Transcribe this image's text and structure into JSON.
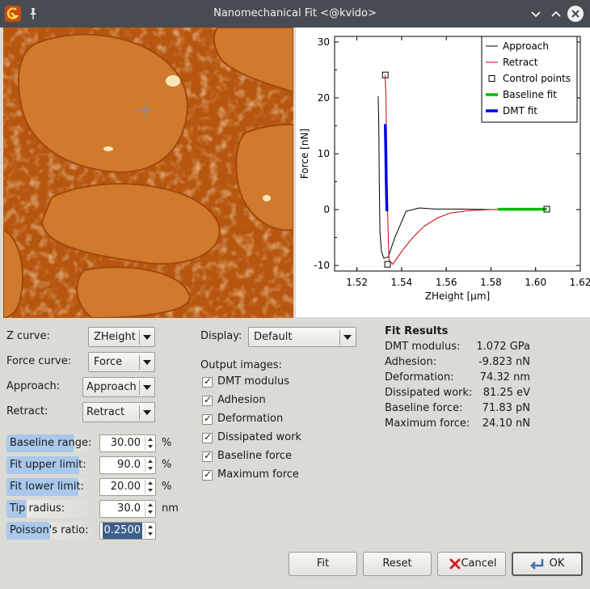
{
  "window": {
    "title": "Nanomechanical Fit <@kvido>",
    "minimize_icon": "chevron-down",
    "maximize_icon": "chevron-up",
    "close_icon": "close"
  },
  "chart_data": {
    "type": "line",
    "xlabel": "ZHeight [µm]",
    "ylabel": "Force [nN]",
    "xlim": [
      1.51,
      1.62
    ],
    "ylim": [
      -11,
      31
    ],
    "xticks": [
      "1.52",
      "1.54",
      "1.56",
      "1.58",
      "1.60",
      "1.62"
    ],
    "yticks": [
      "-10",
      "0",
      "10",
      "20",
      "30"
    ],
    "legend_position": "top-right",
    "legend": [
      "Approach",
      "Retract",
      "Control points",
      "Baseline fit",
      "DMT fit"
    ],
    "series": [
      {
        "name": "Approach",
        "color": "#000000",
        "x": [
          1.5295,
          1.5298,
          1.53,
          1.5303,
          1.531,
          1.532,
          1.534,
          1.537,
          1.542,
          1.548,
          1.555,
          1.565,
          1.58,
          1.595,
          1.605
        ],
        "y": [
          20.3,
          15.0,
          5.0,
          -4.0,
          -7.5,
          -8.7,
          -8.5,
          -5.0,
          -0.3,
          0.3,
          0.1,
          0.1,
          0.0,
          0.05,
          0.0
        ]
      },
      {
        "name": "Retract",
        "color": "#cc0000",
        "x": [
          1.5326,
          1.533,
          1.5333,
          1.5337,
          1.5343,
          1.536,
          1.54,
          1.545,
          1.55,
          1.556,
          1.562,
          1.57,
          1.58,
          1.595,
          1.605
        ],
        "y": [
          24.1,
          20.0,
          10.0,
          0.0,
          -9.0,
          -9.8,
          -7.5,
          -5.0,
          -3.0,
          -1.5,
          -0.6,
          -0.2,
          0.0,
          0.0,
          0.0
        ]
      },
      {
        "name": "Baseline fit",
        "color": "#00bb00",
        "x": [
          1.583,
          1.605
        ],
        "y": [
          0.07,
          0.07
        ]
      },
      {
        "name": "DMT fit",
        "color": "#0000ee",
        "x": [
          1.5327,
          1.5329,
          1.5331,
          1.5334
        ],
        "y": [
          15.3,
          11.0,
          6.0,
          -0.3
        ]
      },
      {
        "name": "Control points",
        "color": "#000000",
        "x": [
          1.5327,
          1.5337,
          1.605
        ],
        "y": [
          24.1,
          -9.8,
          0.07
        ]
      }
    ]
  },
  "controls": {
    "z_curve": {
      "label": "Z curve:",
      "value": "ZHeight"
    },
    "force_curve": {
      "label": "Force curve:",
      "value": "Force"
    },
    "approach": {
      "label": "Approach:",
      "value": "Approach"
    },
    "retract": {
      "label": "Retract:",
      "value": "Retract"
    },
    "display": {
      "label": "Display:",
      "value": "Default"
    }
  },
  "params": [
    {
      "label": "Baseline range:",
      "value": "30.00",
      "unit": "%"
    },
    {
      "label": "Fit upper limit:",
      "value": "90.0",
      "unit": "%"
    },
    {
      "label": "Fit lower limit:",
      "value": "20.00",
      "unit": "%"
    },
    {
      "label": "Tip radius:",
      "value": "30.0",
      "unit": "nm"
    },
    {
      "label": "Poisson's ratio:",
      "value": "0.2500",
      "unit": ""
    }
  ],
  "output": {
    "title": "Output images:",
    "items": [
      "DMT modulus",
      "Adhesion",
      "Deformation",
      "Dissipated work",
      "Baseline force",
      "Maximum force"
    ]
  },
  "results": {
    "title": "Fit Results",
    "rows": [
      {
        "label": "DMT modulus:",
        "value": "1.072 GPa"
      },
      {
        "label": "Adhesion:",
        "value": "-9.823 nN"
      },
      {
        "label": "Deformation:",
        "value": "74.32 nm"
      },
      {
        "label": "Dissipated work:",
        "value": "81.25 eV"
      },
      {
        "label": "Baseline force:",
        "value": "71.83 pN"
      },
      {
        "label": "Maximum force:",
        "value": "24.10 nN"
      }
    ]
  },
  "buttons": {
    "fit": "Fit",
    "reset": "Reset",
    "cancel": "Cancel",
    "ok": "OK"
  }
}
